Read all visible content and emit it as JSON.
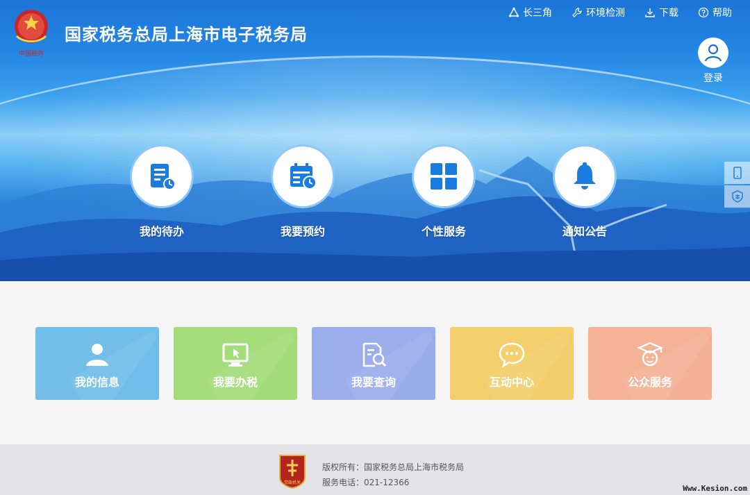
{
  "header": {
    "title": "国家税务总局上海市电子税务局",
    "logo_text": "中国税务"
  },
  "top_links": [
    {
      "label": "长三角",
      "icon": "triangle-network-icon"
    },
    {
      "label": "环境检测",
      "icon": "wrench-icon"
    },
    {
      "label": "下载",
      "icon": "download-icon"
    },
    {
      "label": "帮助",
      "icon": "help-icon"
    }
  ],
  "login": {
    "label": "登录",
    "icon": "user-icon"
  },
  "hero_items": [
    {
      "label": "我的待办",
      "icon": "todo-list-icon"
    },
    {
      "label": "我要预约",
      "icon": "calendar-clock-icon"
    },
    {
      "label": "个性服务",
      "icon": "grid-icon"
    },
    {
      "label": "通知公告",
      "icon": "bell-icon"
    }
  ],
  "side_tools": [
    {
      "icon": "mobile-icon"
    },
    {
      "icon": "tax-shield-icon"
    }
  ],
  "cards": [
    {
      "label": "我的信息",
      "icon": "user-icon",
      "color": "#66b9e8"
    },
    {
      "label": "我要办税",
      "icon": "monitor-icon",
      "color": "#9cd96e"
    },
    {
      "label": "我要查询",
      "icon": "search-document-icon",
      "color": "#93a7ea"
    },
    {
      "label": "互动中心",
      "icon": "chat-icon",
      "color": "#f2ca5f"
    },
    {
      "label": "公众服务",
      "icon": "graduate-icon",
      "color": "#f4ab8c"
    }
  ],
  "footer": {
    "copyright": "版权所有：国家税务总局上海市税务局",
    "phone": "服务电话：021-12366",
    "badge_text": "党政机关"
  },
  "watermark": "Www.Kesion.com"
}
